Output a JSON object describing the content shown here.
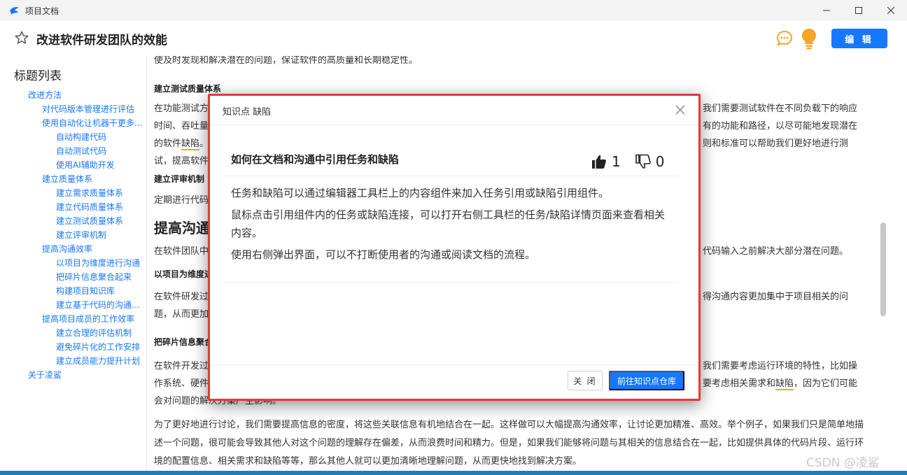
{
  "window": {
    "title": "项目文档",
    "controls": [
      "minimize",
      "maximize",
      "close"
    ]
  },
  "header": {
    "doc_title": "改进软件研发团队的效能",
    "edit_label": "编 辑"
  },
  "sidebar": {
    "heading": "标题列表",
    "items": [
      {
        "label": "改进方法",
        "level": 1
      },
      {
        "label": "对代码版本管理进行评估",
        "level": 2
      },
      {
        "label": "使用自动化让机器干更多...",
        "level": 2
      },
      {
        "label": "自动构建代码",
        "level": 3
      },
      {
        "label": "自动测试代码",
        "level": 3
      },
      {
        "label": "使用AI辅助开发",
        "level": 3
      },
      {
        "label": "建立质量体系",
        "level": 2
      },
      {
        "label": "建立需求质量体系",
        "level": 3
      },
      {
        "label": "建立代码质量体系",
        "level": 3
      },
      {
        "label": "建立测试质量体系",
        "level": 3
      },
      {
        "label": "建立评审机制",
        "level": 3
      },
      {
        "label": "提高沟通效率",
        "level": 2
      },
      {
        "label": "以项目为维度进行沟通",
        "level": 3
      },
      {
        "label": "把碎片信息聚合起来",
        "level": 3
      },
      {
        "label": "构建项目知识库",
        "level": 3
      },
      {
        "label": "建立基于代码的沟通机...",
        "level": 3
      },
      {
        "label": "提高项目成员的工作效率",
        "level": 2
      },
      {
        "label": "建立合理的评估机制",
        "level": 3
      },
      {
        "label": "避免碎片化的工作安排",
        "level": 3
      },
      {
        "label": "建立成员能力提升计划",
        "level": 3
      },
      {
        "label": "关于凌鲨",
        "level": 1
      }
    ]
  },
  "content": {
    "p0": "使及时发现和解决潜在的问题，保证软件的高质量和长期稳定性。",
    "h_test": "建立测试质量体系",
    "p1a": "在功能测试方",
    "p1b": "我们需要测试软件在不同负载下的响应",
    "p1c": "时间、吞吐量",
    "p1d": "有的功能和路径，以尽可能地发现潜在",
    "p1e": "的软件",
    "p1_hl": "缺陷",
    "p1f": "。",
    "p1g": "则和标准可以帮助我们更好地进行测",
    "p1h": "试，提高软件",
    "h_review": "建立评审机制",
    "p2a": "定期进行代码",
    "h2_comm": "提高沟通",
    "p3a": "在软件团队中",
    "p3b": "代码输入之前解决大部分潜在问题。",
    "h_proj": "以项目为维度进",
    "p4a": "在软件研发过",
    "p4b": "得沟通内容更加集中于项目相关的问",
    "p4c": "题，从而更加",
    "h_frag": "把碎片信息聚合",
    "p5a": "在软件开发过",
    "p5b": "我们需要考虑运行环境的特性，比如操",
    "p5c": "作系统、硬件",
    "p5d": "要考虑相关需求和",
    "p5_hl": "缺陷",
    "p5e": "，因为它们可能",
    "p5f": "会对问题的解决方案产生影响。",
    "p6": "为了更好地进行讨论，我们需要提高信息的密度，将这些关联信息有机地结合在一起。这样做可以大幅提高沟通效率，让讨论更加精准、高效。举个例子，如果我们只是简单地描述一个问题，很可能会导致其他人对这个问题的理解存在偏差，从而浪费时间和精力。但是，如果我们能够将问题与其相关的信息结合在一起，比如提供具体的代码片段、运行环境的配置信息、相关需求和缺陷等等，那么其他人就可以更加清晰地理解问题，从而更快地找到解决方案。"
  },
  "modal": {
    "title": "知识点 缺陷",
    "article_title": "如何在文档和沟通中引用任务和缺陷",
    "likes": "1",
    "dislikes": "0",
    "paragraphs": [
      "任务和缺陷可以通过编辑器工具栏上的内容组件来加入任务引用或缺陷引用组件。",
      "鼠标点击引用组件内的任务或缺陷连接，可以打开右侧工具栏的任务/缺陷详情页面来查看相关内容。",
      "使用右侧弹出界面，可以不打断使用者的沟通或阅读文档的流程。"
    ],
    "close_label": "关 闭",
    "go_label": "前往知识点仓库"
  },
  "watermark": "CSDN @凌鲨",
  "colors": {
    "accent": "#1677ff",
    "highlight_underline": "#f5a623",
    "modal_outline": "#e53935",
    "bulb": "#f5a623"
  }
}
